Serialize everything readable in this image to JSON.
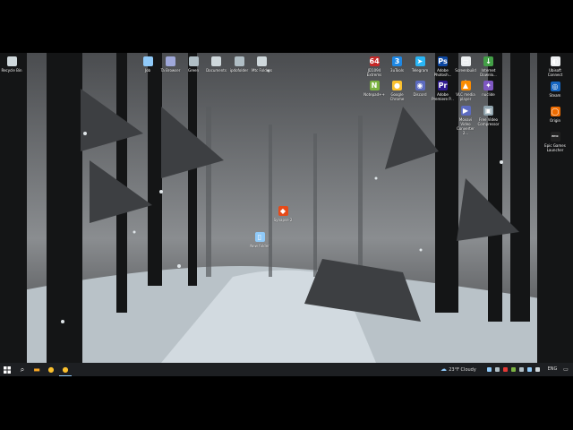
{
  "desktop": {
    "icons_left": [
      {
        "label": "Recycle Bin",
        "icon": "recycle-bin-icon",
        "color": "#cfd8dc"
      }
    ],
    "icons_top": [
      {
        "label": "Job",
        "icon": "file-icon",
        "color": "#90caf9"
      },
      {
        "label": "Ta Browser",
        "icon": "file-icon",
        "color": "#9fa8da"
      },
      {
        "label": "Green",
        "icon": "file-icon",
        "color": "#b0bec5"
      },
      {
        "label": "Documents",
        "icon": "file-icon",
        "color": "#cfd8dc"
      },
      {
        "label": "ipdofolder",
        "icon": "file-icon",
        "color": "#b0bec5"
      },
      {
        "label": "Mtc Folders",
        "icon": "file-icon",
        "color": "#cfd8dc"
      }
    ],
    "icons_right_row1": [
      {
        "label": "JD1094 Extrems",
        "icon": "app-64-icon",
        "glyph": "64",
        "color": "#c62828"
      },
      {
        "label": "3uTools",
        "icon": "app-3u-icon",
        "glyph": "3",
        "color": "#1e88e5"
      },
      {
        "label": "Telegram",
        "icon": "telegram-icon",
        "glyph": "➤",
        "color": "#29b6f6"
      },
      {
        "label": "Adobe Photosh...",
        "icon": "photoshop-icon",
        "glyph": "Ps",
        "color": "#0d47a1"
      },
      {
        "label": "Screenbuild",
        "icon": "screen-icon",
        "glyph": "▭",
        "color": "#eceff1"
      },
      {
        "label": "Internet Downlo...",
        "icon": "internet-download-icon",
        "glyph": "↓",
        "color": "#43a047"
      }
    ],
    "icons_right_row2": [
      {
        "label": "Notepad++",
        "icon": "notepad-icon",
        "glyph": "N",
        "color": "#7cb342"
      },
      {
        "label": "Google Chrome",
        "icon": "chrome-icon",
        "glyph": "●",
        "color": "#fbc02d"
      },
      {
        "label": "Discord",
        "icon": "discord-icon",
        "glyph": "◉",
        "color": "#5c6bc0"
      },
      {
        "label": "Adobe Premiere P...",
        "icon": "premiere-icon",
        "glyph": "Pr",
        "color": "#311b92"
      },
      {
        "label": "VLC media player",
        "icon": "vlc-icon",
        "glyph": "▲",
        "color": "#fb8c00"
      },
      {
        "label": "nuclide",
        "icon": "nuclide-icon",
        "glyph": "✦",
        "color": "#7e57c2"
      }
    ],
    "icons_right_row3": [
      {
        "label": "Movavi Video Converter 2...",
        "icon": "movavi-icon",
        "glyph": "▶",
        "color": "#5c6bc0"
      },
      {
        "label": "Free Video Compressor",
        "icon": "video-compressor-icon",
        "glyph": "▣",
        "color": "#90a4ae"
      }
    ],
    "icons_far_right": [
      {
        "label": "Ubisoft Connect",
        "icon": "ubisoft-icon",
        "glyph": "◐",
        "color": "#eceff1"
      },
      {
        "label": "Steam",
        "icon": "steam-icon",
        "glyph": "◎",
        "color": "#1565c0"
      },
      {
        "label": "Origin",
        "icon": "origin-icon",
        "glyph": "◯",
        "color": "#ef6c00"
      },
      {
        "label": "Epic Games Launcher",
        "icon": "epic-icon",
        "glyph": "EPIC",
        "color": "#212121"
      }
    ],
    "icons_center": [
      {
        "label": "Synapse 2",
        "icon": "synapse-icon",
        "glyph": "◆",
        "color": "#e64a19"
      },
      {
        "label": "New folder",
        "icon": "new-folder-icon",
        "glyph": "▯",
        "color": "#90caf9"
      }
    ]
  },
  "taskbar": {
    "start_icon": "windows-start-icon",
    "search_icon": "search-icon",
    "pinned": [
      {
        "name": "file-explorer-icon",
        "color": "#f9a825",
        "glyph": "▬"
      },
      {
        "name": "chrome-icon",
        "color": "#fbc02d",
        "glyph": "●"
      },
      {
        "name": "chrome-icon",
        "color": "#fbc02d",
        "glyph": "●"
      }
    ],
    "weather": "23°F  Cloudy",
    "language": "ENG",
    "tray_colors": [
      "#90caf9",
      "#b0bec5",
      "#e53935",
      "#7cb342",
      "#b0bec5",
      "#90caf9",
      "#cfd8dc"
    ]
  }
}
